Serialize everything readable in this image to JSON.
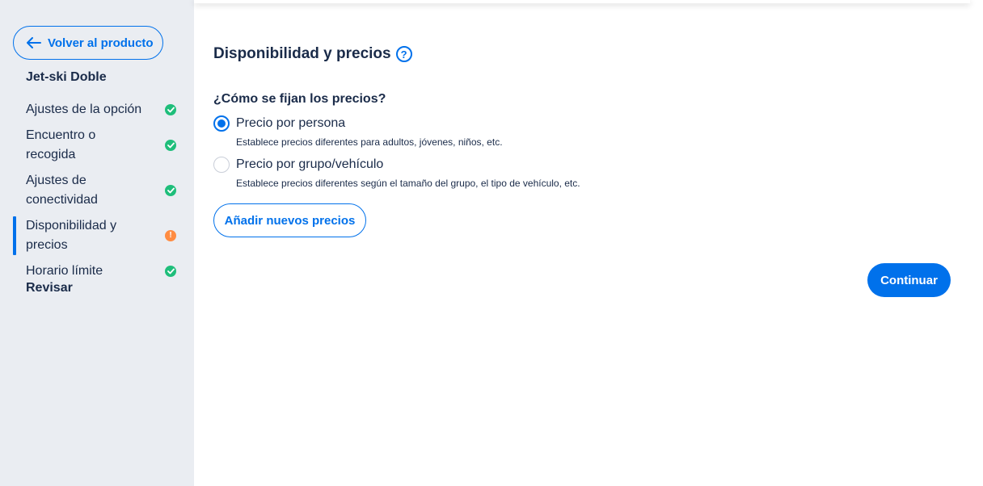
{
  "sidebar": {
    "back_label": "Volver al producto",
    "product_name": "Jet-ski Doble",
    "items": [
      {
        "label": "Ajustes de la opción",
        "status": "complete"
      },
      {
        "label": "Encuentro o recogida",
        "status": "complete"
      },
      {
        "label": "Ajustes de conectividad",
        "status": "complete"
      },
      {
        "label": "Disponibilidad y precios",
        "status": "warning"
      },
      {
        "label": "Horario límite",
        "status": "complete"
      }
    ],
    "review_label": "Revisar"
  },
  "main": {
    "title": "Disponibilidad y precios",
    "help_glyph": "?",
    "question": "¿Cómo se fijan los precios?",
    "options": [
      {
        "label": "Precio por persona",
        "description": "Establece precios diferentes para adultos, jóvenes, niños, etc.",
        "selected": true
      },
      {
        "label": "Precio por grupo/vehículo",
        "description": "Establece precios diferentes según el tamaño del grupo, el tipo de vehículo, etc.",
        "selected": false
      }
    ],
    "add_prices_label": "Añadir nuevos precios",
    "continue_label": "Continuar"
  },
  "colors": {
    "accent": "#0071eb",
    "complete": "#1fbe7b",
    "warning": "#ff8c42",
    "sidebar_bg": "#eaedf2",
    "text": "#1a2b49"
  }
}
